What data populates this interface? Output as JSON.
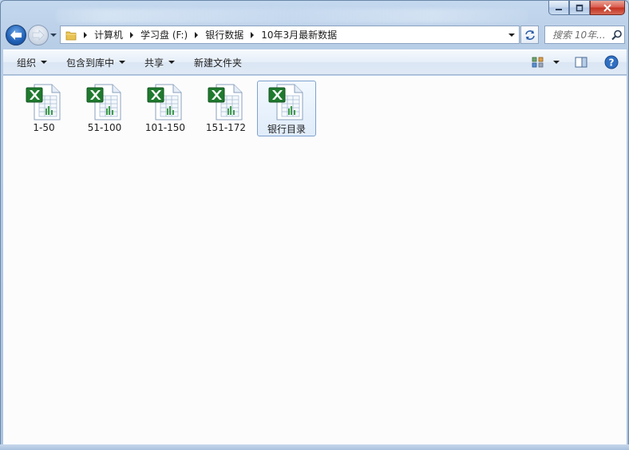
{
  "window": {
    "caption_buttons": [
      "minimize-icon",
      "maximize-icon",
      "close-icon"
    ]
  },
  "nav": {
    "back_icon": "back-arrow-icon",
    "forward_icon": "forward-arrow-icon"
  },
  "address": {
    "crumbs": [
      "计算机",
      "学习盘 (F:)",
      "银行数据",
      "10年3月最新数据"
    ]
  },
  "search": {
    "placeholder": "搜索 10年..."
  },
  "toolbar": {
    "organize_label": "组织",
    "include_label": "包含到库中",
    "share_label": "共享",
    "new_folder_label": "新建文件夹"
  },
  "files": [
    {
      "name": "1-50",
      "icon": "excel-file-icon",
      "selected": false
    },
    {
      "name": "51-100",
      "icon": "excel-file-icon",
      "selected": false
    },
    {
      "name": "101-150",
      "icon": "excel-file-icon",
      "selected": false
    },
    {
      "name": "151-172",
      "icon": "excel-file-icon",
      "selected": false
    },
    {
      "name": "银行目录",
      "icon": "excel-file-icon",
      "selected": true
    }
  ],
  "colors": {
    "selection_border": "#7da2ce",
    "excel_green": "#1f7a2e",
    "back_button_blue": "#1f5fb5"
  }
}
